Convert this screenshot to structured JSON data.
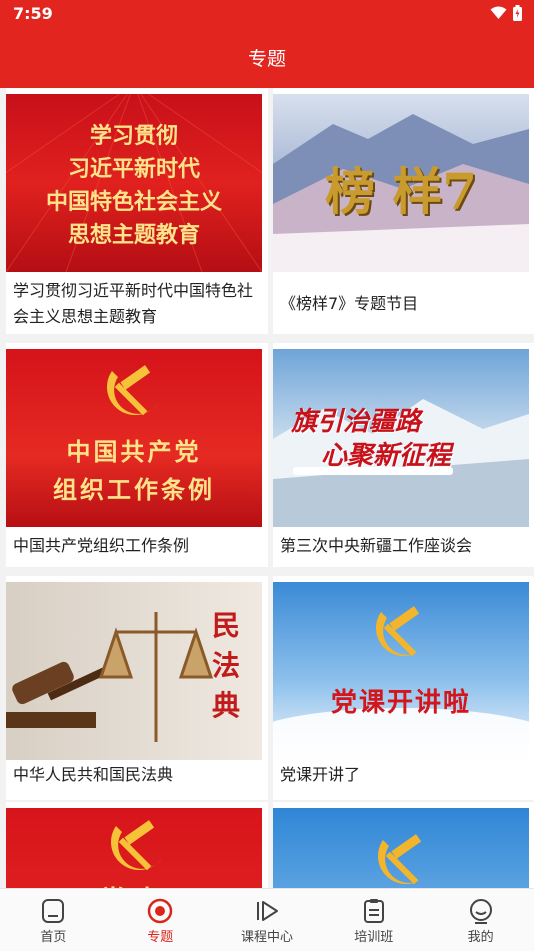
{
  "status": {
    "time": "7:59"
  },
  "header": {
    "title": "专题"
  },
  "cards": [
    {
      "title": "学习贯彻习近平新时代中国特色社会主义思想主题教育",
      "poster": [
        "学习贯彻",
        "习近平新时代",
        "中国特色社会主义",
        "思想主题教育"
      ]
    },
    {
      "title": "《榜样7》专题节目",
      "poster": [
        "榜 样7"
      ]
    },
    {
      "title": "中国共产党组织工作条例",
      "poster": [
        "中国共产党",
        "组织工作条例"
      ]
    },
    {
      "title": "第三次中央新疆工作座谈会",
      "poster": [
        "旗引治疆路",
        "心聚新征程"
      ]
    },
    {
      "title": "中华人民共和国民法典",
      "poster": [
        "民",
        "法",
        "典"
      ]
    },
    {
      "title": "党课开讲了",
      "poster": [
        "党课开讲啦"
      ]
    },
    {
      "title": "",
      "poster": [
        "党史"
      ]
    },
    {
      "title": "",
      "poster": []
    }
  ],
  "nav": [
    {
      "label": "首页",
      "icon": "home-icon",
      "active": false
    },
    {
      "label": "专题",
      "icon": "topic-icon",
      "active": true
    },
    {
      "label": "课程中心",
      "icon": "course-play-icon",
      "active": false
    },
    {
      "label": "培训班",
      "icon": "clipboard-icon",
      "active": false
    },
    {
      "label": "我的",
      "icon": "profile-face-icon",
      "active": false
    }
  ],
  "colors": {
    "primary": "#e2261f",
    "active_nav": "#d9261c"
  }
}
